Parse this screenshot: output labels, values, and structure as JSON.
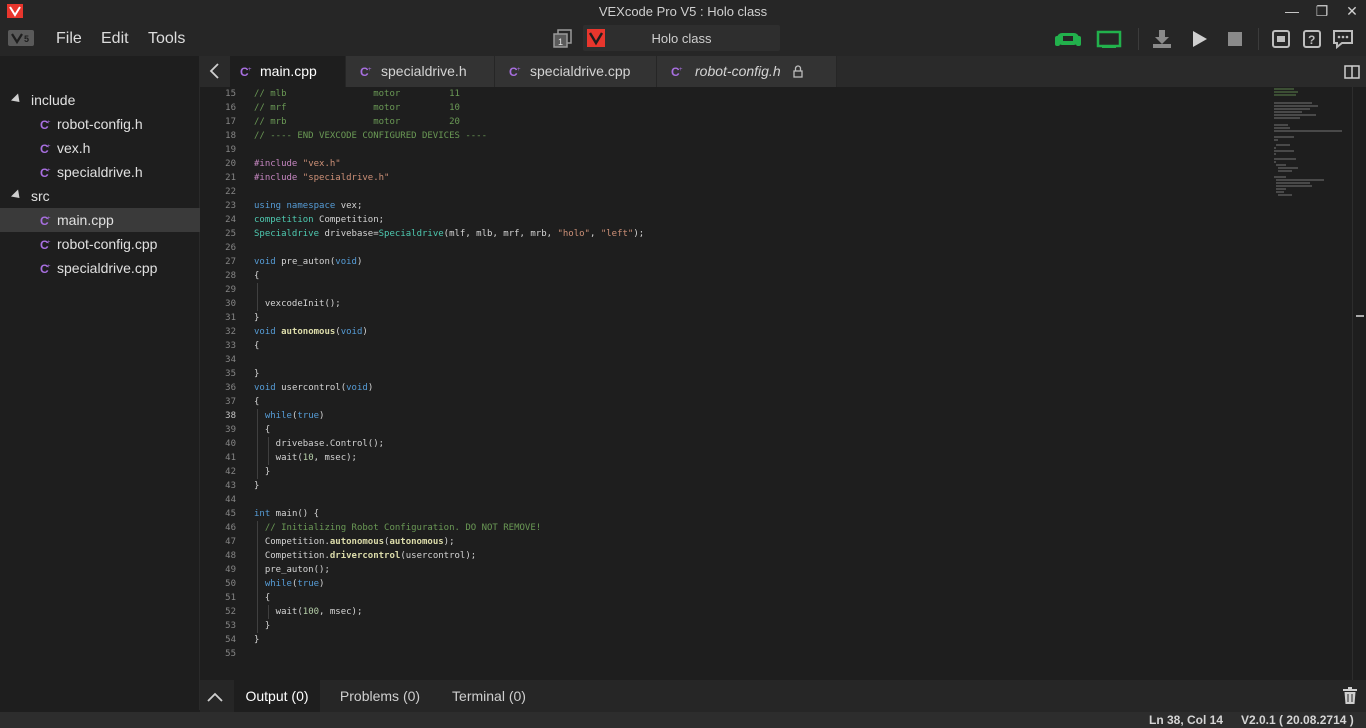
{
  "window": {
    "title": "VEXcode Pro V5 : Holo class",
    "controls": {
      "minimize": "—",
      "maximize": "❐",
      "close": "✕"
    }
  },
  "menubar": {
    "menus": [
      "File",
      "Edit",
      "Tools"
    ],
    "project_name": "Holo class",
    "toolbar_icons": [
      "controller-icon",
      "brain-icon",
      "download-icon",
      "play-icon",
      "stop-icon",
      "device-info-icon",
      "help-icon",
      "feedback-icon"
    ],
    "colors": {
      "controller": "#22b14c",
      "brain": "#22b14c",
      "accent_red": "#e8362d"
    }
  },
  "sidebar": {
    "folders": [
      {
        "name": "include",
        "files": [
          "robot-config.h",
          "vex.h",
          "specialdrive.h"
        ]
      },
      {
        "name": "src",
        "files": [
          "main.cpp",
          "robot-config.cpp",
          "specialdrive.cpp"
        ]
      }
    ],
    "selected_file": "main.cpp"
  },
  "tabs": [
    {
      "label": "main.cpp",
      "active": true,
      "locked": false
    },
    {
      "label": "specialdrive.h",
      "active": false,
      "locked": false
    },
    {
      "label": "specialdrive.cpp",
      "active": false,
      "locked": false
    },
    {
      "label": "robot-config.h",
      "active": false,
      "locked": true
    }
  ],
  "editor": {
    "current_line": 38,
    "lines": [
      {
        "n": "15",
        "text": "// mlb                motor         11"
      },
      {
        "n": "16",
        "text": "// mrf                motor         10"
      },
      {
        "n": "17",
        "text": "// mrb                motor         20"
      },
      {
        "n": "18",
        "text": "// ---- END VEXCODE CONFIGURED DEVICES ----"
      },
      {
        "n": "19",
        "text": ""
      },
      {
        "n": "20",
        "text": "#include \"vex.h\""
      },
      {
        "n": "21",
        "text": "#include \"specialdrive.h\""
      },
      {
        "n": "22",
        "text": ""
      },
      {
        "n": "23",
        "text": "using namespace vex;"
      },
      {
        "n": "24",
        "text": "competition Competition;"
      },
      {
        "n": "25",
        "text": "Specialdrive drivebase=Specialdrive(mlf, mlb, mrf, mrb, \"holo\", \"left\");"
      },
      {
        "n": "26",
        "text": ""
      },
      {
        "n": "27",
        "text": "void pre_auton(void)"
      },
      {
        "n": "28",
        "text": "{"
      },
      {
        "n": "29",
        "text": ""
      },
      {
        "n": "30",
        "text": "  vexcodeInit();"
      },
      {
        "n": "31",
        "text": "}"
      },
      {
        "n": "32",
        "text": "void autonomous(void)"
      },
      {
        "n": "33",
        "text": "{"
      },
      {
        "n": "34",
        "text": ""
      },
      {
        "n": "35",
        "text": "}"
      },
      {
        "n": "36",
        "text": "void usercontrol(void)"
      },
      {
        "n": "37",
        "text": "{"
      },
      {
        "n": "38",
        "text": "  while(true)"
      },
      {
        "n": "39",
        "text": "  {"
      },
      {
        "n": "40",
        "text": "    drivebase.Control();"
      },
      {
        "n": "41",
        "text": "    wait(10, msec);"
      },
      {
        "n": "42",
        "text": "  }"
      },
      {
        "n": "43",
        "text": "}"
      },
      {
        "n": "44",
        "text": ""
      },
      {
        "n": "45",
        "text": "int main() {"
      },
      {
        "n": "46",
        "text": "  // Initializing Robot Configuration. DO NOT REMOVE!"
      },
      {
        "n": "47",
        "text": "  Competition.autonomous(autonomous);"
      },
      {
        "n": "48",
        "text": "  Competition.drivercontrol(usercontrol);"
      },
      {
        "n": "49",
        "text": "  pre_auton();"
      },
      {
        "n": "50",
        "text": "  while(true)"
      },
      {
        "n": "51",
        "text": "  {"
      },
      {
        "n": "52",
        "text": "    wait(100, msec);"
      },
      {
        "n": "53",
        "text": "  }"
      },
      {
        "n": "54",
        "text": "}"
      },
      {
        "n": "55",
        "text": ""
      }
    ]
  },
  "panel": {
    "tabs": [
      "Output (0)",
      "Problems (0)",
      "Terminal (0)"
    ],
    "active": "Output (0)"
  },
  "status": {
    "position": "Ln 38, Col 14",
    "version": "V2.0.1 ( 20.08.2714 )"
  }
}
